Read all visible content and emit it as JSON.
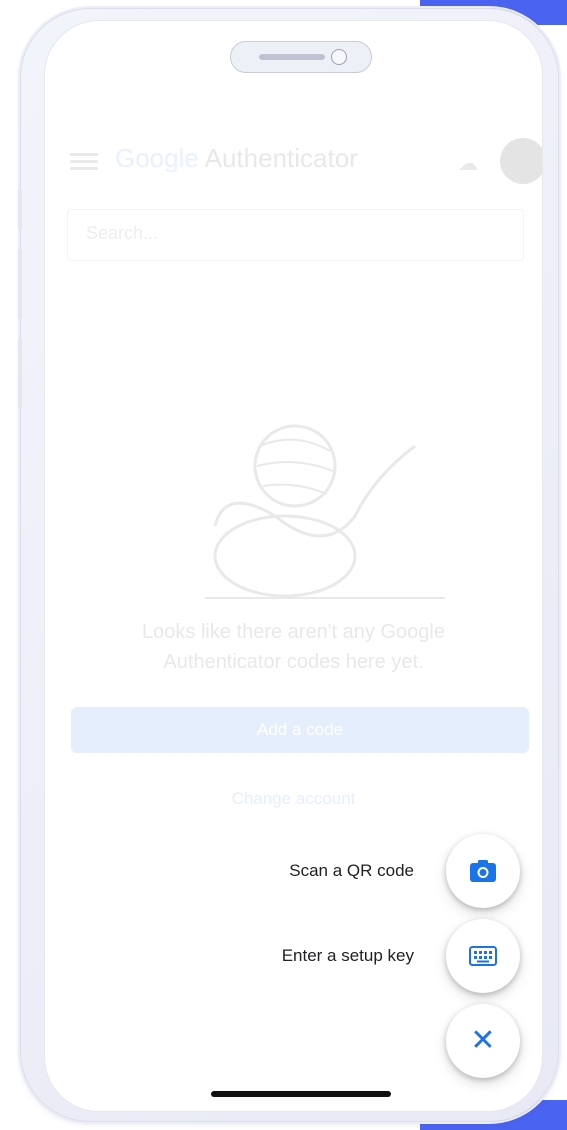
{
  "app": {
    "title_g": "Google",
    "title_rest": " Authenticator",
    "search_placeholder": "Search...",
    "empty_message_line1": "Looks like there aren't any Google",
    "empty_message_line2": "Authenticator codes here yet.",
    "add_code_label": "Add a code",
    "change_account_label": "Change account"
  },
  "fab_menu": {
    "items": [
      {
        "label": "Scan a QR code",
        "icon": "camera-icon"
      },
      {
        "label": "Enter a setup key",
        "icon": "keyboard-icon"
      }
    ],
    "close_icon": "close-icon",
    "close_glyph": "✕"
  },
  "colors": {
    "accent": "#1a73e8",
    "background_accent": "#4a63f0"
  }
}
